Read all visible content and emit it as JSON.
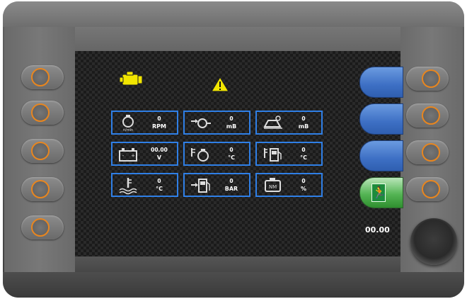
{
  "status": {
    "engine_icon": "engine-warning-icon",
    "warning_icon": "warning-triangle-icon",
    "engine_color": "#f2e600",
    "warning_color": "#f2e600"
  },
  "tiles": [
    {
      "icon": "engine-speed-icon",
      "value": "0",
      "unit": "RPM",
      "icon_caption": "n/min"
    },
    {
      "icon": "turbo-pressure-icon",
      "value": "0",
      "unit": "mB"
    },
    {
      "icon": "ambient-pressure-icon",
      "value": "0",
      "unit": "mB"
    },
    {
      "icon": "battery-icon",
      "value": "00.00",
      "unit": "V"
    },
    {
      "icon": "intake-temperature-icon",
      "value": "0",
      "unit": "°C"
    },
    {
      "icon": "fuel-temperature-icon",
      "value": "0",
      "unit": "°C"
    },
    {
      "icon": "coolant-temperature-icon",
      "value": "0",
      "unit": "°C"
    },
    {
      "icon": "fuel-pressure-icon",
      "value": "0",
      "unit": "BAR"
    },
    {
      "icon": "engine-torque-icon",
      "value": "0",
      "unit": "%",
      "icon_caption": "NM"
    }
  ],
  "softkeys": [
    {
      "name": "softkey-1",
      "label": ""
    },
    {
      "name": "softkey-2",
      "label": ""
    },
    {
      "name": "softkey-3",
      "label": ""
    },
    {
      "name": "exit-softkey",
      "icon": "exit-icon",
      "label": ""
    }
  ],
  "readout": {
    "value": "00.00"
  },
  "colors": {
    "tile_border": "#2f7fe6",
    "accent_ring": "#e8861f",
    "softkey": "#3d6fc4",
    "exit": "#55b555"
  }
}
